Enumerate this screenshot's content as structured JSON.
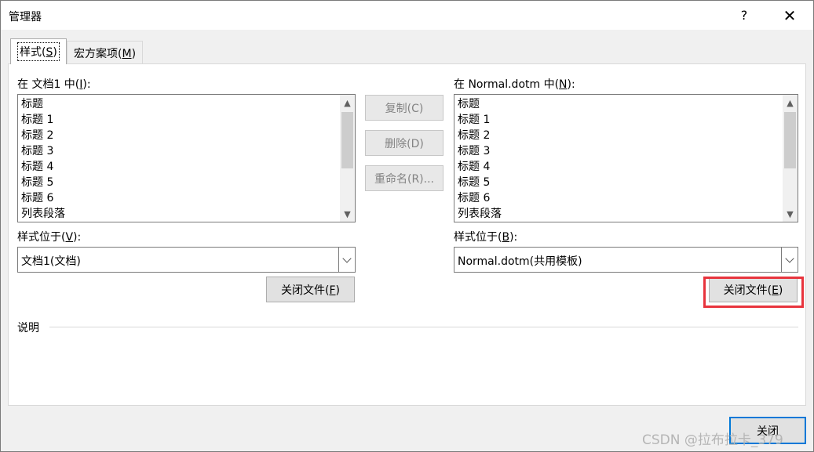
{
  "window": {
    "title": "管理器",
    "help_label": "?",
    "close_label": "✕"
  },
  "tabs": [
    {
      "label": "样式",
      "mnemonic_prefix": "(",
      "mnemonic": "S",
      "mnemonic_suffix": ")"
    },
    {
      "label": "宏方案项",
      "mnemonic_prefix": "(",
      "mnemonic": "M",
      "mnemonic_suffix": ")"
    }
  ],
  "left": {
    "list_label": "在 文档1 中(",
    "list_mnemonic": "I",
    "list_label_suffix": "):",
    "items": [
      "标题",
      "标题 1",
      "标题 2",
      "标题 3",
      "标题 4",
      "标题 5",
      "标题 6",
      "列表段落"
    ],
    "location_label": "样式位于(",
    "location_mnemonic": "V",
    "location_suffix": "):",
    "location_value": "文档1(文档)",
    "close_file_label": "关闭文件(",
    "close_file_mnemonic": "F",
    "close_file_suffix": ")"
  },
  "middle": {
    "copy_label": "复制(C)",
    "delete_label": "删除(D)",
    "rename_label": "重命名(R)..."
  },
  "right": {
    "list_label": "在 Normal.dotm 中(",
    "list_mnemonic": "N",
    "list_label_suffix": "):",
    "items": [
      "标题",
      "标题 1",
      "标题 2",
      "标题 3",
      "标题 4",
      "标题 5",
      "标题 6",
      "列表段落"
    ],
    "location_label": "样式位于(",
    "location_mnemonic": "B",
    "location_suffix": "):",
    "location_value": "Normal.dotm(共用模板)",
    "close_file_label": "关闭文件(",
    "close_file_mnemonic": "E",
    "close_file_suffix": ")"
  },
  "description_label": "说明",
  "footer": {
    "close_button": "关闭"
  },
  "watermark": "CSDN @拉布拉卡_379",
  "colors": {
    "highlight": "#e8343d",
    "window_bg": "#f0f0f0"
  }
}
